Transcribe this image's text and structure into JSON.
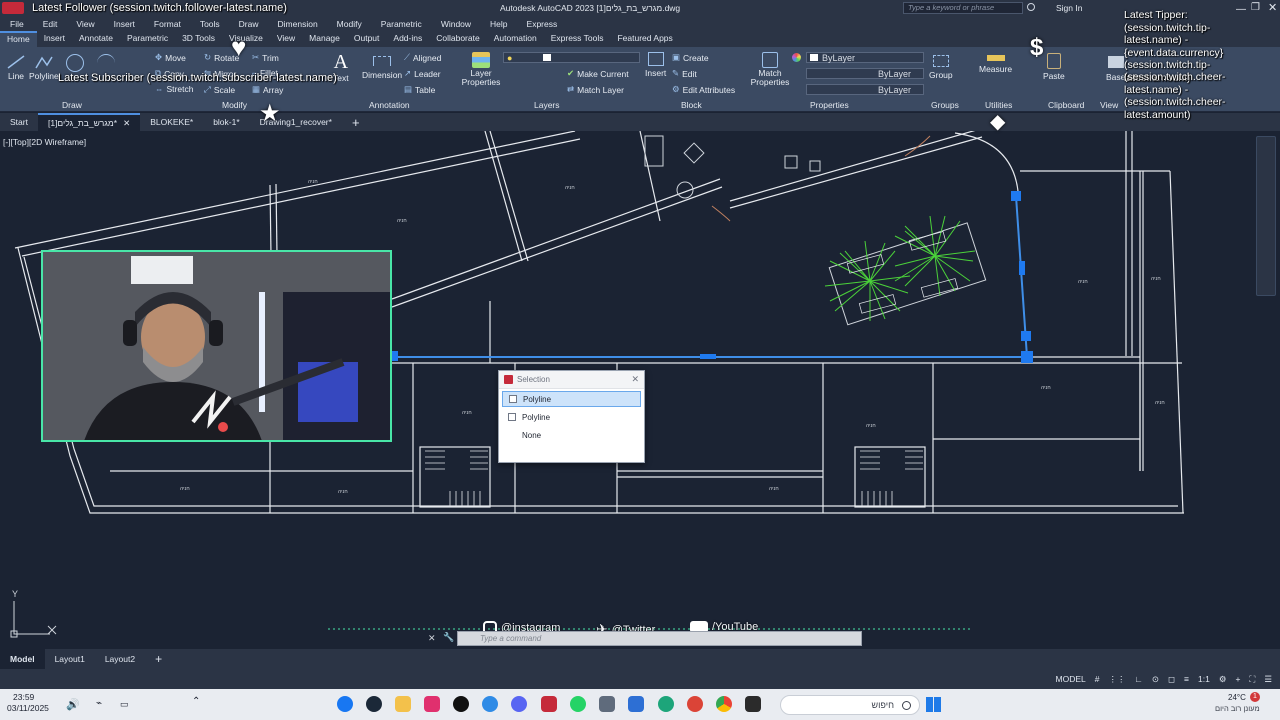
{
  "window": {
    "title": "Autodesk AutoCAD 2023   מגרש_בת_גלים[1].dwg",
    "search_placeholder": "Type a keyword or phrase",
    "sign_in": "Sign In"
  },
  "menu": [
    "File",
    "Edit",
    "View",
    "Insert",
    "Format",
    "Tools",
    "Draw",
    "Dimension",
    "Modify",
    "Parametric",
    "Window",
    "Help",
    "Express"
  ],
  "ribbon_tabs": [
    "Home",
    "Insert",
    "Annotate",
    "Parametric",
    "3D Tools",
    "Visualize",
    "View",
    "Manage",
    "Output",
    "Add-ins",
    "Collaborate",
    "Automation",
    "Express Tools",
    "Featured Apps"
  ],
  "ribbon": {
    "draw": {
      "line": "Line",
      "polyline": "Polyline",
      "title": "Draw"
    },
    "modify": {
      "move": "Move",
      "rotate": "Rotate",
      "trim": "Trim",
      "copy": "Copy",
      "mirror": "Mirror",
      "fillet": "Fillet",
      "stretch": "Stretch",
      "scale": "Scale",
      "array": "Array",
      "title": "Modify"
    },
    "annotation": {
      "text": "Text",
      "dimension": "Dimension",
      "aligned": "Aligned",
      "leader": "Leader",
      "table": "Table",
      "title": "Annotation"
    },
    "layers": {
      "layer_properties": "Layer Properties",
      "make_current": "Make Current",
      "match_layer": "Match Layer",
      "title": "Layers"
    },
    "block": {
      "insert": "Insert",
      "create": "Create",
      "edit": "Edit",
      "edit_attributes": "Edit Attributes",
      "title": "Block"
    },
    "properties": {
      "match_properties": "Match Properties",
      "bylayer1": "ByLayer",
      "bylayer2": "ByLayer",
      "bylayer3": "ByLayer",
      "title": "Properties"
    },
    "groups": {
      "group": "Group",
      "title": "Groups"
    },
    "utilities": {
      "measure": "Measure",
      "title": "Utilities"
    },
    "clipboard": {
      "paste": "Paste",
      "title": "Clipboard"
    },
    "view": {
      "base": "Base",
      "title": "View"
    }
  },
  "doc_tabs": [
    "Start",
    "מגרש_בת_גלים[1]*",
    "BLOKEKE*",
    "blok-1*",
    "Drawing1_recover*"
  ],
  "viewport_label": "[-][Top][2D Wireframe]",
  "selection_dialog": {
    "title": "Selection",
    "items": [
      "Polyline",
      "Polyline",
      "None"
    ]
  },
  "room_labels": [
    "חניה",
    "חניה",
    "חניה",
    "חניה",
    "חניה",
    "חניה",
    "חניה",
    "חניה",
    "חניה",
    "חניה",
    "חניה",
    "חניה"
  ],
  "overlay": {
    "follower": "Latest Follower (session.twitch.follower-latest.name)",
    "subscriber": "Latest Subscriber (session.twitch.subscriber-latest.name)",
    "tipper": "Latest Tipper:\n(session.twitch.tip-\nlatest.name) -\n{event.data.currency}\n(session.twitch.tip-\nlatest.amount)",
    "cheer": "(session.twitch.cheer-\nlatest.name) -\n(session.twitch.cheer-\nlatest.amount)",
    "instagram": "@instagram",
    "twitter": "@Twitter",
    "youtube": "/YouTube"
  },
  "command_placeholder": "Type a command",
  "layout_tabs": [
    "Model",
    "Layout1",
    "Layout2"
  ],
  "status": {
    "model": "MODEL",
    "scale": "1:1"
  },
  "taskbar": {
    "time": "23:59",
    "date": "03/11/2025",
    "search": "חיפוש",
    "weather_temp": "24°C",
    "weather_desc": "מעונן רוב היום",
    "notifications": "1"
  },
  "colors": {
    "accent": "#4f8fe0",
    "canvas": "#1b2333",
    "ribbon": "#3b4a62",
    "webcam_border": "#49e6a8",
    "selection": "#3f8ee8"
  }
}
